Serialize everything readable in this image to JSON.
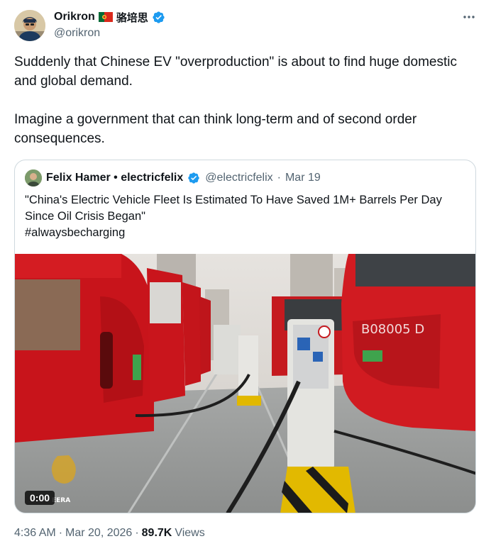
{
  "author": {
    "name": "Orikron",
    "name_cjk": "骆培思",
    "handle": "@orikron",
    "colors": {
      "flag_green": "#046a38",
      "flag_red": "#da291c",
      "verified": "#1d9bf0"
    }
  },
  "more_icon": "more-horizontal-icon",
  "tweet": {
    "paragraph_1": "Suddenly that Chinese EV \"overproduction\" is about to find huge domestic and global demand.",
    "paragraph_2": "Imagine a government that can think long-term and of second order consequences."
  },
  "quote": {
    "name": "Felix Hamer • electricfelix",
    "handle": "@electricfelix",
    "separator": "·",
    "date": "Mar 19",
    "text": "\"China's Electric Vehicle Fleet Is Estimated To Have Saved 1M+ Barrels Per Day Since Oil Crisis Began\"",
    "hashtag": "#alwaysbecharging",
    "video": {
      "time": "0:00",
      "bus_plate": "B08005 D",
      "watermark": "EERA"
    }
  },
  "meta": {
    "time": "4:36 AM",
    "separator": "·",
    "date": "Mar 20, 2026",
    "separator_2": "·",
    "views": "89.7K",
    "views_label": "Views"
  }
}
